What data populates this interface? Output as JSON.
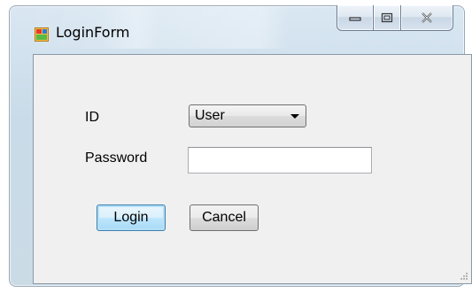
{
  "window": {
    "title": "LoginForm"
  },
  "form": {
    "id_label": "ID",
    "id_selected": "User",
    "password_label": "Password",
    "password_value": "",
    "login_label": "Login",
    "cancel_label": "Cancel"
  },
  "icons": {
    "app": "winform-app-icon",
    "minimize": "minimize-icon",
    "maximize": "maximize-icon",
    "close": "close-icon",
    "dropdown": "chevron-down-icon"
  },
  "colors": {
    "focus_button_border": "#3c7fb1",
    "client_background": "#f0f0f0"
  }
}
